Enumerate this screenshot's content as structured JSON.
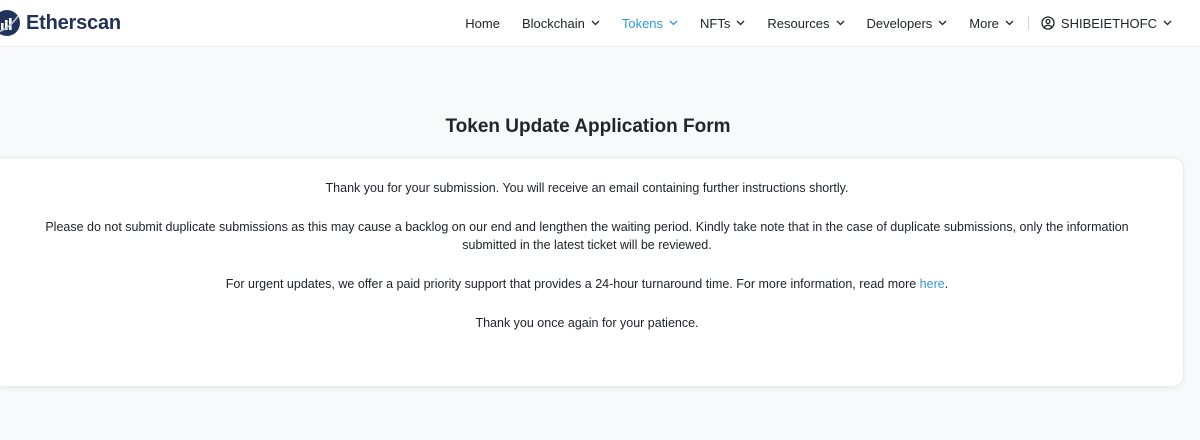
{
  "brand": {
    "name": "Etherscan"
  },
  "nav": {
    "items": [
      {
        "label": "Home"
      },
      {
        "label": "Blockchain"
      },
      {
        "label": "Tokens"
      },
      {
        "label": "NFTs"
      },
      {
        "label": "Resources"
      },
      {
        "label": "Developers"
      },
      {
        "label": "More"
      }
    ],
    "user": "SHIBEIETHOFC"
  },
  "main": {
    "title": "Token Update Application Form",
    "message_1": "Thank you for your submission. You will receive an email containing further instructions shortly.",
    "message_2": "Please do not submit duplicate submissions as this may cause a backlog on our end and lengthen the waiting period. Kindly take note that in the case of duplicate submissions, only the information submitted in the latest ticket will be reviewed.",
    "message_3_prefix": "For urgent updates, we offer a paid priority support that provides a 24-hour turnaround time. For more information, read more ",
    "message_3_link": "here",
    "message_3_suffix": ".",
    "message_4": "Thank you once again for your patience."
  },
  "colors": {
    "brand": "#21325b",
    "accent": "#3498db",
    "background": "#f8f9fa",
    "text": "#212529"
  },
  "icons": {
    "logo": "etherscan-logo-icon",
    "chevron": "chevron-down-icon",
    "user": "user-circle-icon"
  }
}
